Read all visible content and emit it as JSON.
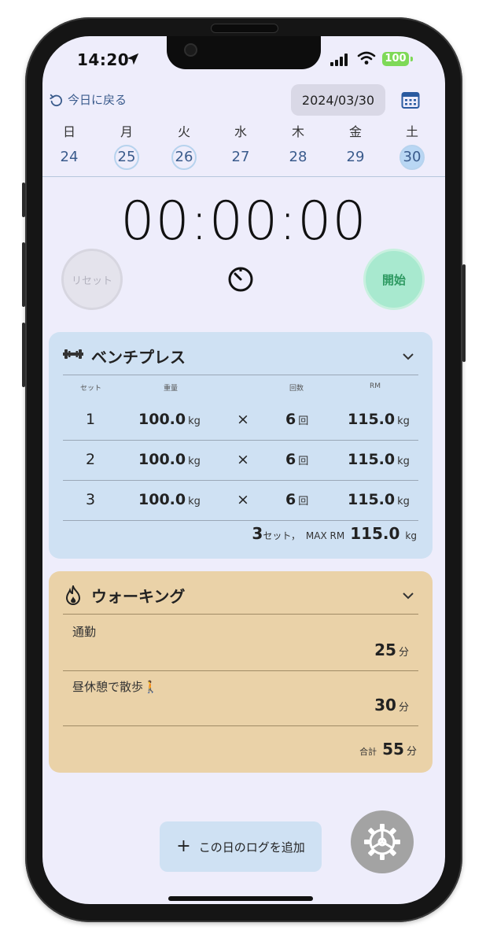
{
  "status_bar": {
    "time": "14:20",
    "battery": "100"
  },
  "header": {
    "back_today_label": "今日に戻る",
    "date": "2024/03/30"
  },
  "week": [
    {
      "name": "日",
      "date": "24",
      "state": "normal"
    },
    {
      "name": "月",
      "date": "25",
      "state": "ring"
    },
    {
      "name": "火",
      "date": "26",
      "state": "ring"
    },
    {
      "name": "水",
      "date": "27",
      "state": "normal"
    },
    {
      "name": "木",
      "date": "28",
      "state": "normal"
    },
    {
      "name": "金",
      "date": "29",
      "state": "normal"
    },
    {
      "name": "土",
      "date": "30",
      "state": "selected"
    }
  ],
  "timer": {
    "display": "00:00:00",
    "reset_label": "リセット",
    "start_label": "開始"
  },
  "bench": {
    "title": "ベンチプレス",
    "headers": {
      "set": "セット",
      "weight": "重量",
      "reps": "回数",
      "rm": "RM"
    },
    "rows": [
      {
        "set": "1",
        "weight": "100.0",
        "weight_unit": "kg",
        "times": "×",
        "reps": "6",
        "reps_unit": "回",
        "rm": "115.0",
        "rm_unit": "kg"
      },
      {
        "set": "2",
        "weight": "100.0",
        "weight_unit": "kg",
        "times": "×",
        "reps": "6",
        "reps_unit": "回",
        "rm": "115.0",
        "rm_unit": "kg"
      },
      {
        "set": "3",
        "weight": "100.0",
        "weight_unit": "kg",
        "times": "×",
        "reps": "6",
        "reps_unit": "回",
        "rm": "115.0",
        "rm_unit": "kg"
      }
    ],
    "summary": {
      "sets": "3",
      "sets_label": "セット，",
      "max_label": "MAX RM",
      "max_rm": "115.0",
      "unit": "kg"
    }
  },
  "walking": {
    "title": "ウォーキング",
    "items": [
      {
        "name": "通勤",
        "minutes": "25",
        "unit": "分"
      },
      {
        "name": "昼休憩で散歩🚶",
        "minutes": "30",
        "unit": "分"
      }
    ],
    "total_label": "合計",
    "total": "55",
    "total_unit": "分"
  },
  "add_log_label": "この日のログを追加"
}
